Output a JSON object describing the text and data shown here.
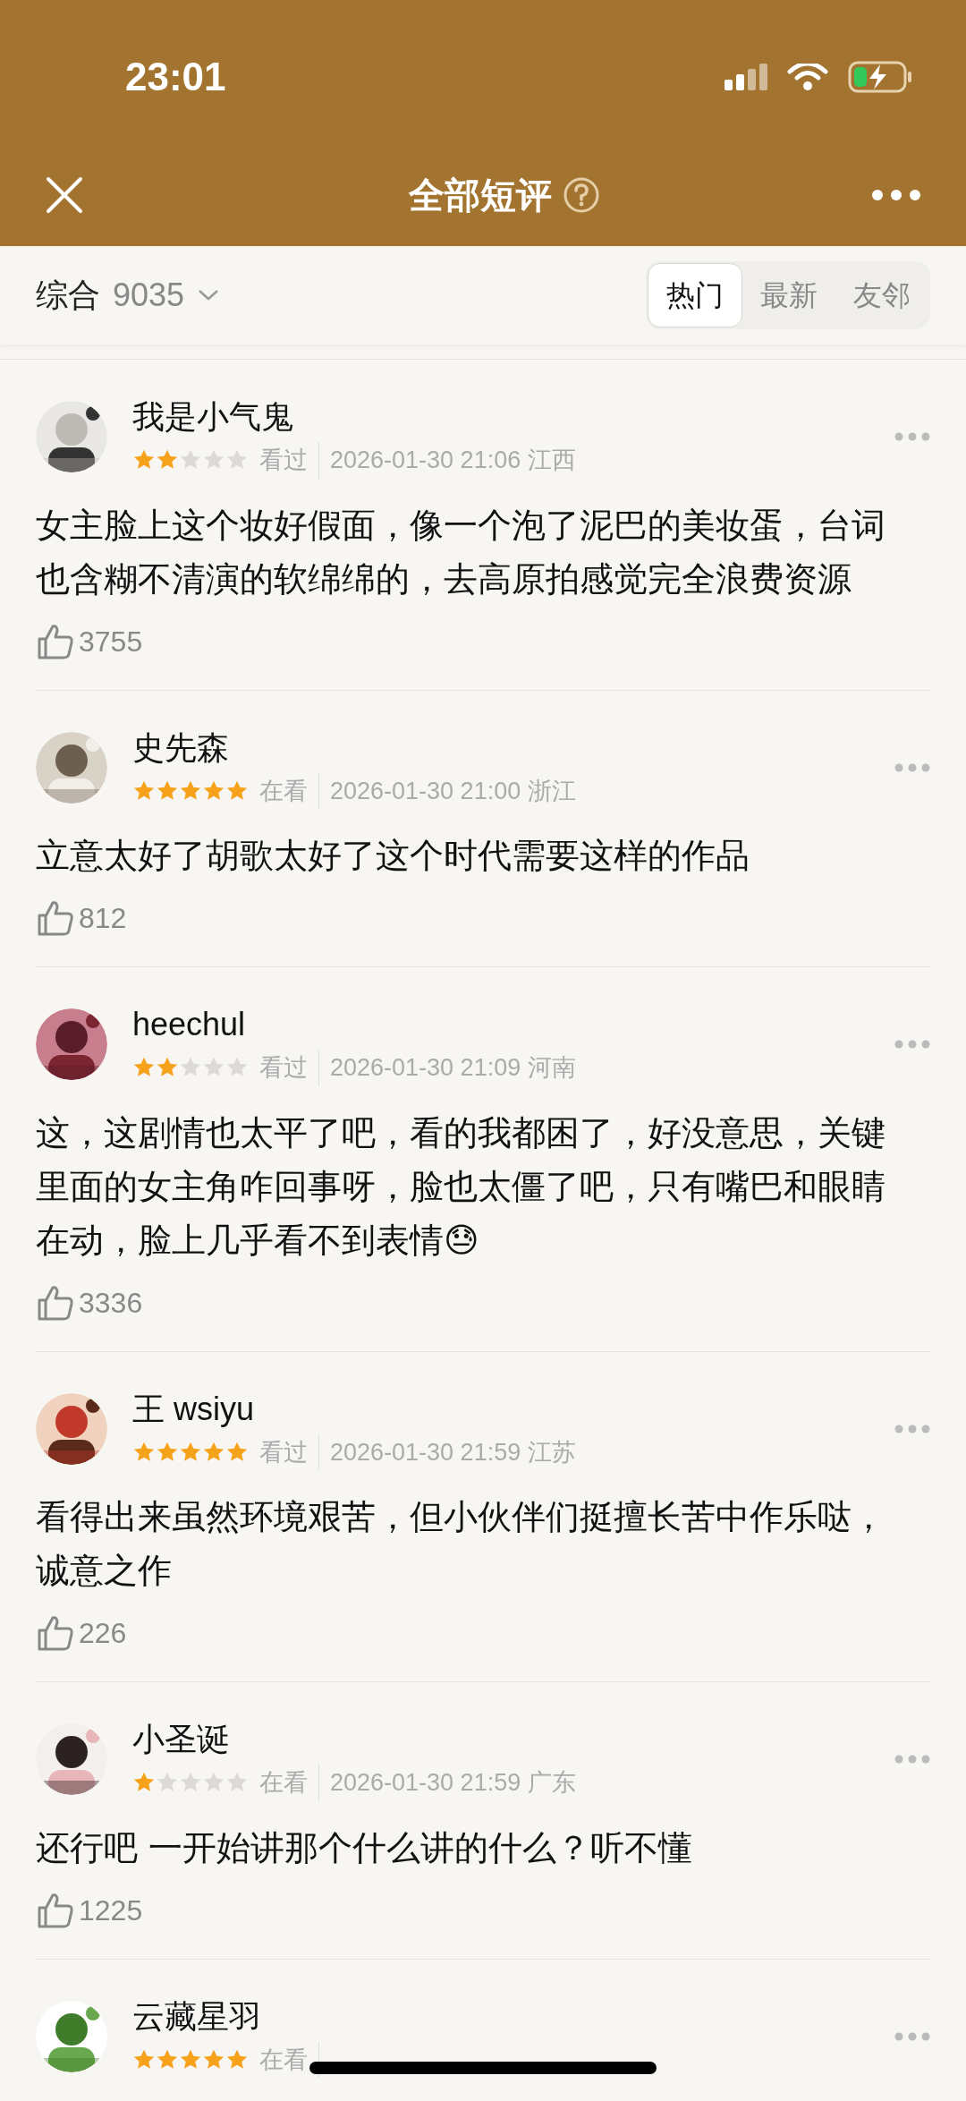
{
  "status_bar": {
    "time": "23:01"
  },
  "header": {
    "title": "全部短评"
  },
  "filter": {
    "label": "综合",
    "count": "9035",
    "tabs": [
      {
        "label": "热门",
        "selected": true
      },
      {
        "label": "最新",
        "selected": false
      },
      {
        "label": "友邻",
        "selected": false
      }
    ]
  },
  "reviews": [
    {
      "name": "我是小气鬼",
      "stars": 2,
      "status": "看过",
      "time": "2026-01-30 21:06",
      "region": "江西",
      "text": "女主脸上这个妆好假面，像一个泡了泥巴的美妆蛋，台词也含糊不清演的软绵绵的，去高原拍感觉完全浪费资源",
      "likes": "3755"
    },
    {
      "name": "史先森",
      "stars": 5,
      "status": "在看",
      "time": "2026-01-30 21:00",
      "region": "浙江",
      "text": "立意太好了胡歌太好了这个时代需要这样的作品",
      "likes": "812"
    },
    {
      "name": "heechul",
      "stars": 2,
      "status": "看过",
      "time": "2026-01-30 21:09",
      "region": "河南",
      "text": "这，这剧情也太平了吧，看的我都困了，好没意思，关键里面的女主角咋回事呀，脸也太僵了吧，只有嘴巴和眼睛在动，脸上几乎看不到表情😓",
      "likes": "3336"
    },
    {
      "name": "王 wsiyu",
      "stars": 5,
      "status": "看过",
      "time": "2026-01-30 21:59",
      "region": "江苏",
      "text": "看得出来虽然环境艰苦，但小伙伴们挺擅长苦中作乐哒，诚意之作",
      "likes": "226"
    },
    {
      "name": "小圣诞",
      "stars": 1,
      "status": "在看",
      "time": "2026-01-30 21:59",
      "region": "广东",
      "text": "还行吧 一开始讲那个什么讲的什么？听不懂",
      "likes": "1225"
    },
    {
      "name": "云藏星羽",
      "stars": 5,
      "status": "在看"
    }
  ]
}
